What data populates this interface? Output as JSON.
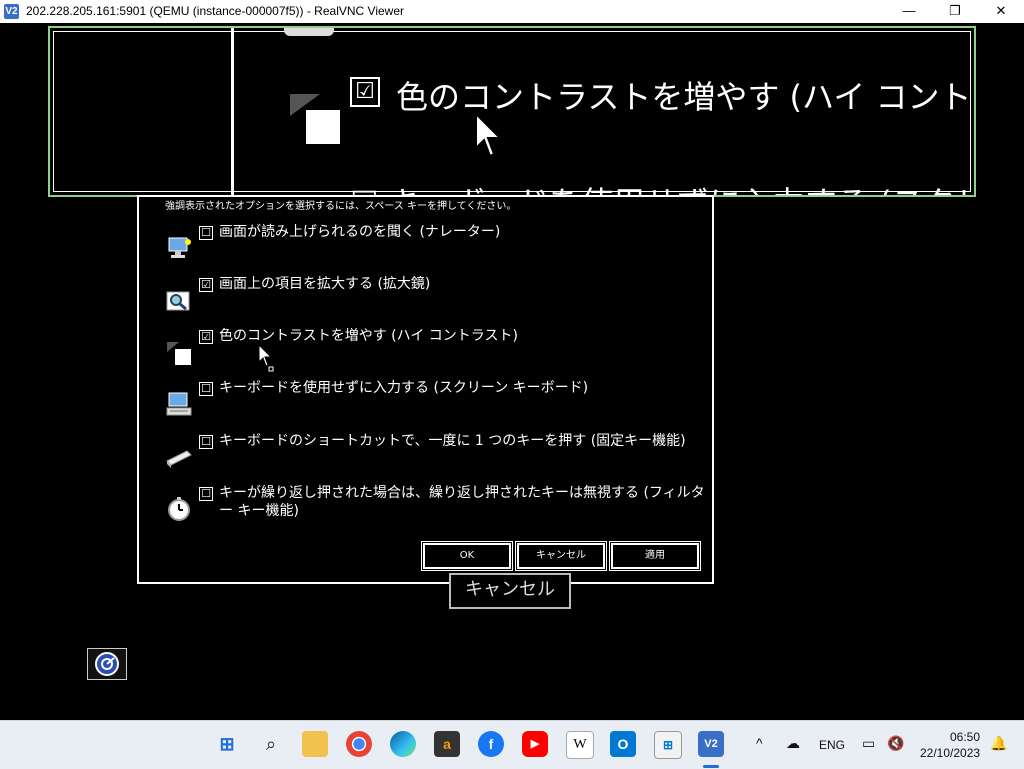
{
  "window": {
    "title": "202.228.205.161:5901 (QEMU (instance-000007f5)) - RealVNC Viewer",
    "app_icon": "V2",
    "minimize": "—",
    "maximize": "❐",
    "close": "✕"
  },
  "magnifier": {
    "line1_check": "☑",
    "line1_text": "色のコントラストを増やす (ハイ コントラスト)",
    "line2_text": "☐ キーボードを使用せずに入力する (スクリー"
  },
  "dialog": {
    "hint": "強調表示されたオプションを選択するには、スペース キーを押してください。",
    "options": [
      {
        "checked": "☐",
        "label": "画面が読み上げられるのを聞く (ナレーター)",
        "icon": "narrator-icon"
      },
      {
        "checked": "☑",
        "label": "画面上の項目を拡大する (拡大鏡)",
        "icon": "magnifier-icon"
      },
      {
        "checked": "☑",
        "label": "色のコントラストを増やす (ハイ コントラスト)",
        "icon": "high-contrast-icon"
      },
      {
        "checked": "☐",
        "label": "キーボードを使用せずに入力する (スクリーン キーボード)",
        "icon": "on-screen-keyboard-icon"
      },
      {
        "checked": "☐",
        "label": "キーボードのショートカットで、一度に 1 つのキーを押す (固定キー機能)",
        "icon": "sticky-keys-icon"
      },
      {
        "checked": "☐",
        "label": "キーが繰り返し押された場合は、繰り返し押されたキーは無視する (フィルター キー機能)",
        "icon": "filter-keys-icon"
      }
    ],
    "ok": "OK",
    "cancel": "キャンセル",
    "apply": "適用"
  },
  "background": {
    "cancel_button": "キャンセル"
  },
  "taskbar": {
    "tray_lang": "ENG",
    "time": "06:50",
    "date": "22/10/2023",
    "chevron": "^"
  }
}
